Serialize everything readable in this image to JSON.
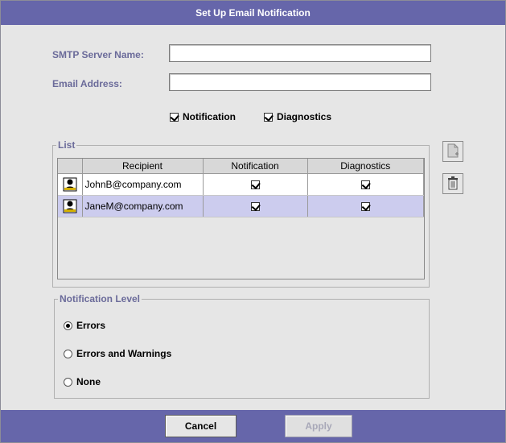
{
  "dialog": {
    "title": "Set Up Email Notification"
  },
  "smtp": {
    "label": "SMTP Server Name:",
    "value": ""
  },
  "email": {
    "label": "Email Address:",
    "value": ""
  },
  "options": {
    "notification": {
      "label": "Notification",
      "checked": true
    },
    "diagnostics": {
      "label": "Diagnostics",
      "checked": true
    }
  },
  "list": {
    "legend": "List",
    "columns": [
      "",
      "Recipient",
      "Notification",
      "Diagnostics"
    ],
    "rows": [
      {
        "recipient": "JohnB@company.com",
        "notification": true,
        "diagnostics": true,
        "selected": false
      },
      {
        "recipient": "JaneM@company.com",
        "notification": true,
        "diagnostics": true,
        "selected": true
      }
    ]
  },
  "side_buttons": {
    "add_icon": "add-document-icon",
    "delete_icon": "trash-icon"
  },
  "notification_level": {
    "legend": "Notification Level",
    "options": [
      {
        "label": "Errors",
        "selected": true
      },
      {
        "label": "Errors and Warnings",
        "selected": false
      },
      {
        "label": "None",
        "selected": false
      }
    ]
  },
  "footer": {
    "cancel_label": "Cancel",
    "apply_label": "Apply",
    "apply_enabled": false
  },
  "colors": {
    "title_bar": "#6666aa",
    "label": "#6b6b9a",
    "selected_row": "#ccccee",
    "dialog_bg": "#e6e6e6"
  }
}
